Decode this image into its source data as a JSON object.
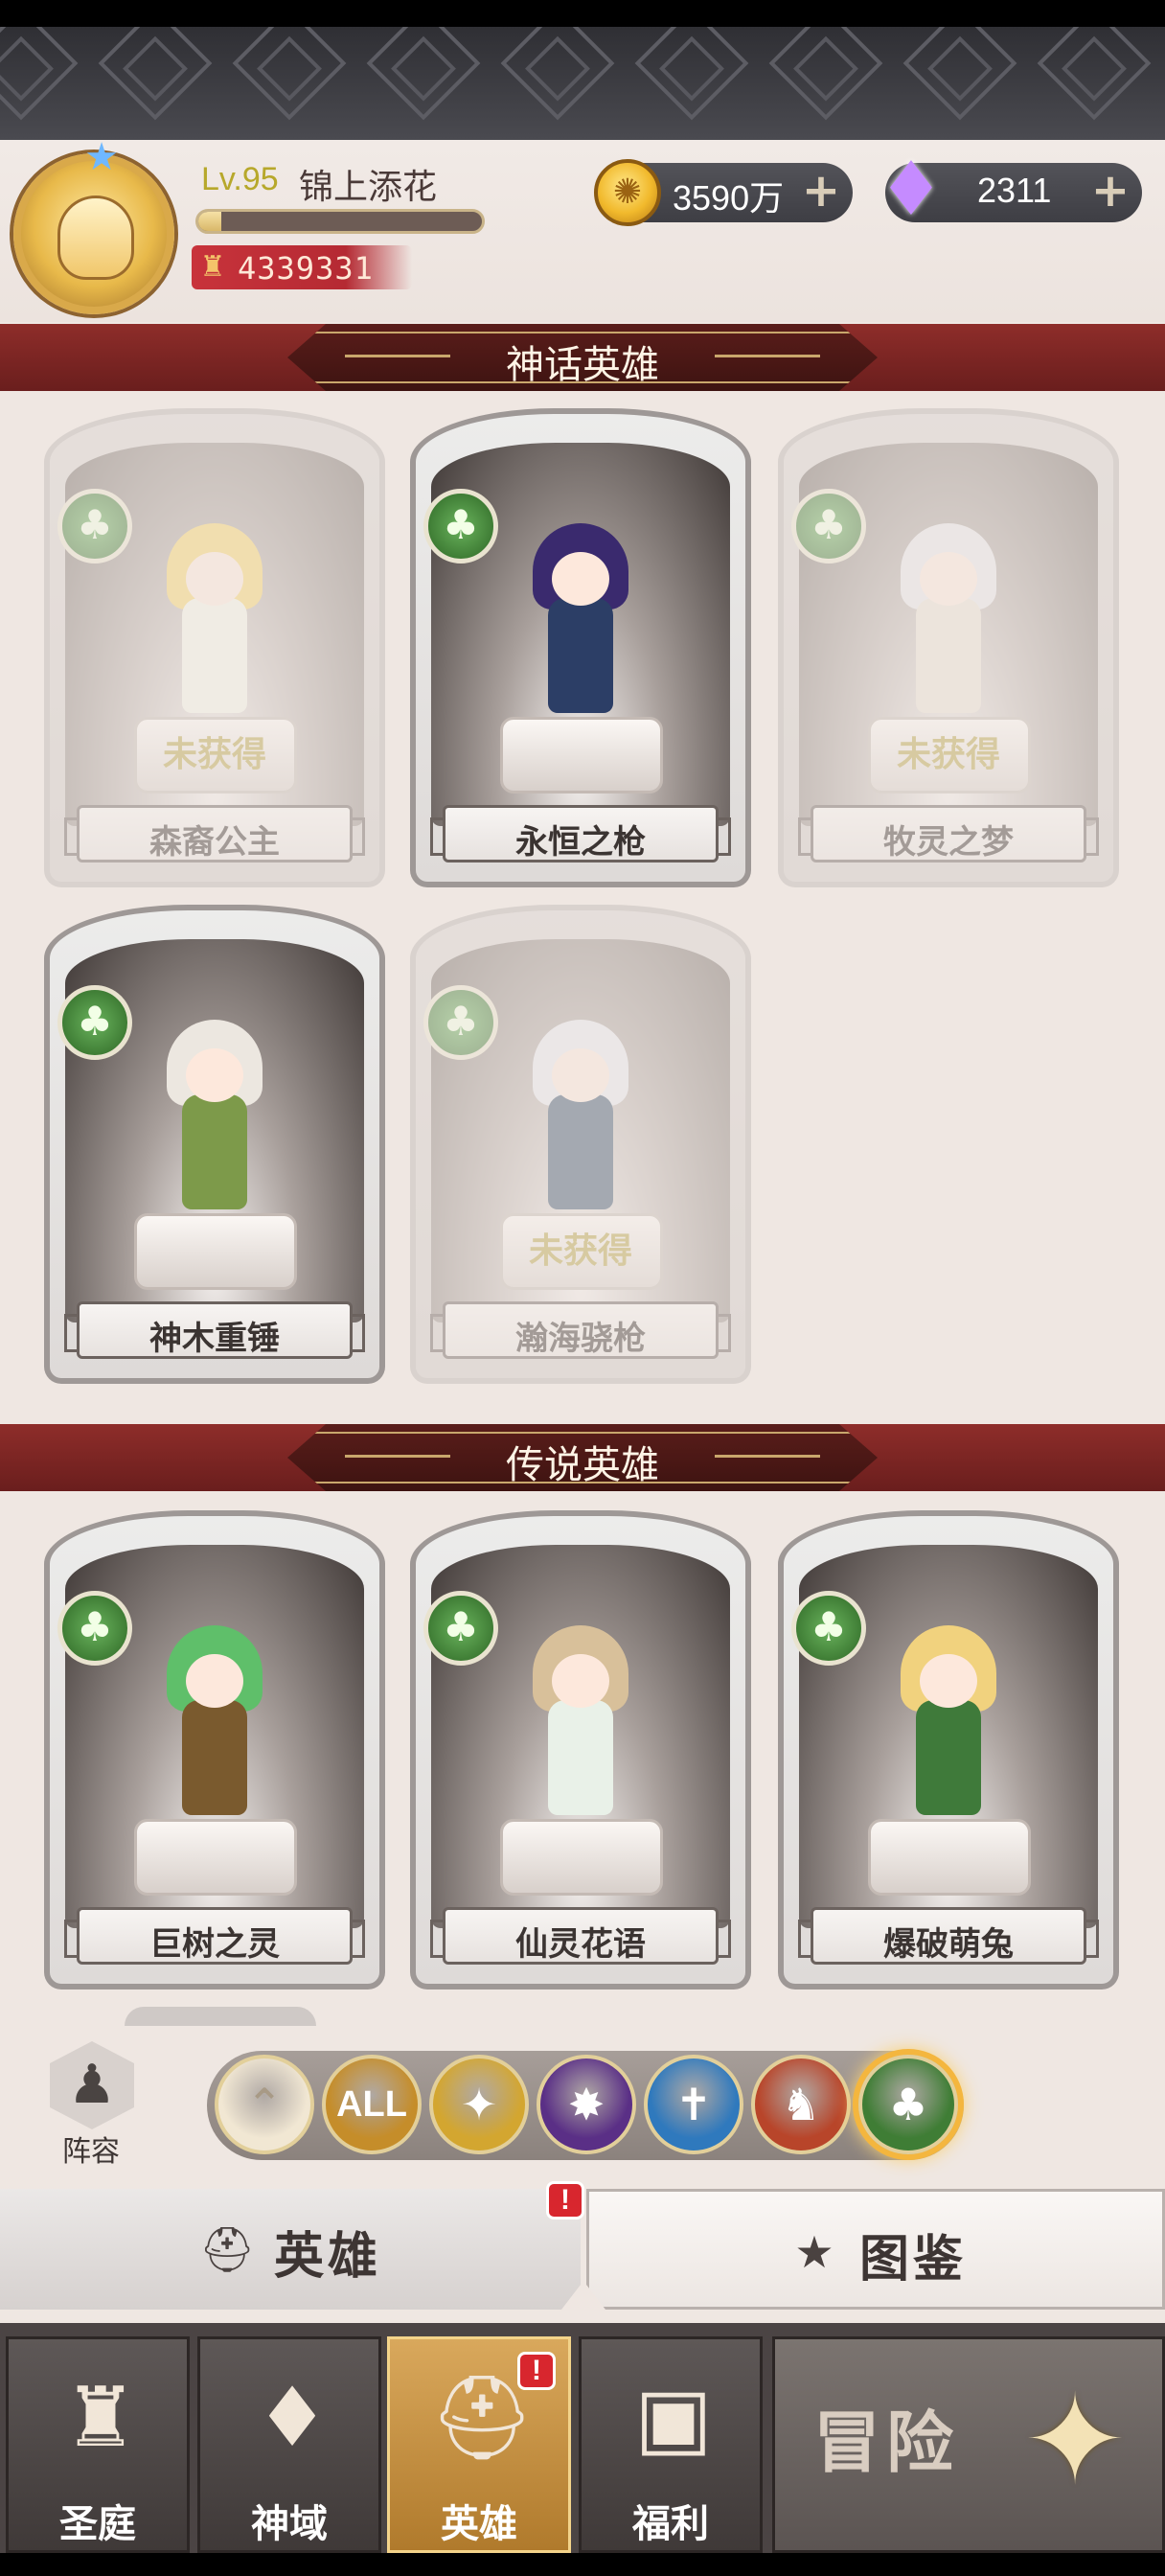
{
  "player": {
    "level": "Lv.95",
    "name": "锦上添花",
    "power": "4339331",
    "exp_fraction": 0.08
  },
  "currency": {
    "gold": "3590万",
    "gems": "2311"
  },
  "sections": {
    "mythic_title": "神话英雄",
    "legend_title": "传说英雄"
  },
  "mythic_heroes": [
    {
      "name": "森裔公主",
      "status": "未获得",
      "owned": false
    },
    {
      "name": "永恒之枪",
      "status": "",
      "owned": true
    },
    {
      "name": "牧灵之梦",
      "status": "未获得",
      "owned": false
    },
    {
      "name": "神木重锤",
      "status": "",
      "owned": true
    },
    {
      "name": "瀚海骁枪",
      "status": "未获得",
      "owned": false
    }
  ],
  "legend_heroes": [
    {
      "name": "巨树之灵",
      "owned": true
    },
    {
      "name": "仙灵花语",
      "owned": true
    },
    {
      "name": "爆破萌兔",
      "owned": true
    }
  ],
  "filter": {
    "lineup_label": "阵容",
    "all_label": "ALL",
    "buttons": [
      {
        "name": "arrow-up-icon",
        "color": "#f1e7d3"
      },
      {
        "name": "all-filter",
        "color": "#c58d2a"
      },
      {
        "name": "light-faction-icon",
        "color": "#d3a630"
      },
      {
        "name": "dark-faction-icon",
        "color": "#5a2f86"
      },
      {
        "name": "holy-faction-icon",
        "color": "#2f79bd"
      },
      {
        "name": "fire-faction-icon",
        "color": "#b8452a"
      },
      {
        "name": "nature-faction-icon",
        "color": "#3f7d35"
      }
    ],
    "active": "nature-faction-icon"
  },
  "subtabs": {
    "hero_label": "英雄",
    "codex_label": "图鉴",
    "alert": "!"
  },
  "nav": {
    "items": [
      "圣庭",
      "神域",
      "英雄",
      "福利"
    ],
    "active": "英雄",
    "alert": "!",
    "adventure_label": "冒险"
  }
}
